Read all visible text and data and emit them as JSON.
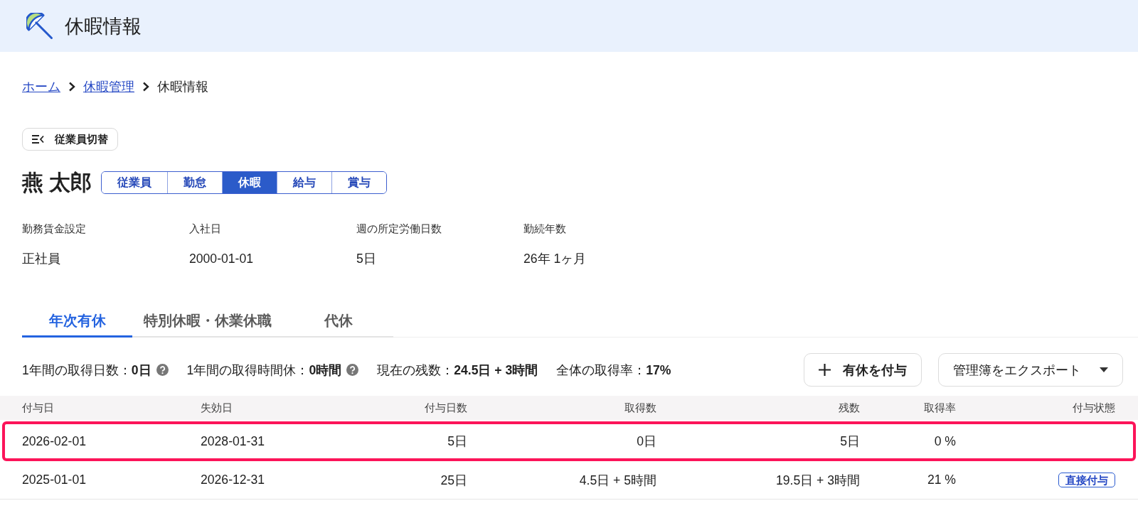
{
  "header": {
    "title": "休暇情報"
  },
  "breadcrumb": [
    {
      "label": "ホーム",
      "kind": "link"
    },
    {
      "label": "休暇管理",
      "kind": "link"
    },
    {
      "label": "休暇情報",
      "kind": "current"
    }
  ],
  "employee_switch": {
    "label": "従業員切替"
  },
  "employee": {
    "name": "燕 太郎",
    "sections": [
      {
        "label": "従業員",
        "selected": false
      },
      {
        "label": "勤怠",
        "selected": false
      },
      {
        "label": "休暇",
        "selected": true
      },
      {
        "label": "給与",
        "selected": false
      },
      {
        "label": "賞与",
        "selected": false
      }
    ]
  },
  "employee_info": [
    {
      "label": "勤務賃金設定",
      "value": "正社員"
    },
    {
      "label": "入社日",
      "value": "2000-01-01"
    },
    {
      "label": "週の所定労働日数",
      "value": "5日"
    },
    {
      "label": "勤続年数",
      "value": "26年 1ヶ月"
    }
  ],
  "leave_tabs": [
    {
      "label": "年次有休",
      "selected": true
    },
    {
      "label": "特別休暇・休業休職",
      "selected": false
    },
    {
      "label": "代休",
      "selected": false
    }
  ],
  "summary": [
    {
      "text": "1年間の取得日数：**0日**",
      "help": true
    },
    {
      "text": "1年間の取得時間休：**0時間**",
      "help": true
    },
    {
      "text": "現在の残数：**24.5日 + 3時間**",
      "help": false
    },
    {
      "text": "全体の取得率：**17%**",
      "help": false
    }
  ],
  "actions": [
    {
      "label": "有休を付与",
      "kind": "add"
    },
    {
      "label": "管理簿をエクスポート",
      "kind": "dropdown"
    }
  ],
  "table": {
    "columns": [
      "付与日",
      "失効日",
      "付与日数",
      "取得数",
      "残数",
      "取得率",
      "付与状態"
    ],
    "rows": [
      {
        "cells": [
          "2026-02-01",
          "2028-01-31",
          "5日",
          "0日",
          "5日",
          "0 %"
        ],
        "highlighted": true
      },
      {
        "cells": [
          "2025-01-01",
          "2026-12-31",
          "25日",
          "4.5日 + 5時間",
          "19.5日 + 3時間",
          "21 %"
        ],
        "status": "直接付与",
        "highlighted": false
      }
    ]
  }
}
